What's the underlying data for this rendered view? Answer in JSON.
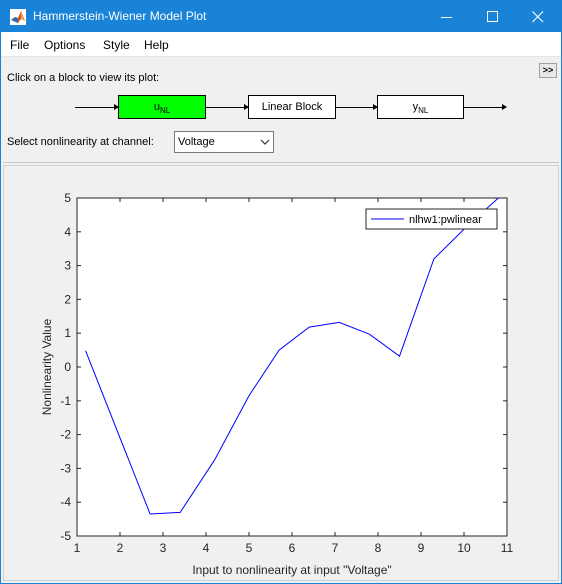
{
  "window": {
    "title": "Hammerstein-Wiener Model Plot"
  },
  "menubar": {
    "items": [
      "File",
      "Options",
      "Style",
      "Help"
    ]
  },
  "panel": {
    "instruction": "Click on a block to view its plot:",
    "expand_label": ">>",
    "blocks": {
      "input_nl": {
        "main": "u",
        "sub": "NL"
      },
      "linear": {
        "label": "Linear Block"
      },
      "output_nl": {
        "main": "y",
        "sub": "NL"
      }
    },
    "channel_label": "Select nonlinearity at channel:",
    "channel_value": "Voltage",
    "active_color": "#00ff00"
  },
  "chart_data": {
    "type": "line",
    "title": "",
    "xlabel": "Input to nonlinearity at input \"Voltage\"",
    "ylabel": "Nonlinearity Value",
    "xlim": [
      1,
      11
    ],
    "ylim": [
      -5,
      5
    ],
    "xticks": [
      1,
      2,
      3,
      4,
      5,
      6,
      7,
      8,
      9,
      10,
      11
    ],
    "yticks": [
      -5,
      -4,
      -3,
      -2,
      -1,
      0,
      1,
      2,
      3,
      4,
      5
    ],
    "grid": false,
    "legend_position": "top-right",
    "series": [
      {
        "name": "nlhw1:pwlinear",
        "color": "#0000ff",
        "x": [
          1.2,
          2.7,
          3.4,
          4.2,
          5.0,
          5.7,
          6.4,
          7.1,
          7.8,
          8.5,
          9.3,
          10.1,
          10.8
        ],
        "y": [
          0.48,
          -4.35,
          -4.3,
          -2.75,
          -0.85,
          0.5,
          1.18,
          1.32,
          0.97,
          0.32,
          3.2,
          4.2,
          5.0
        ]
      }
    ]
  }
}
